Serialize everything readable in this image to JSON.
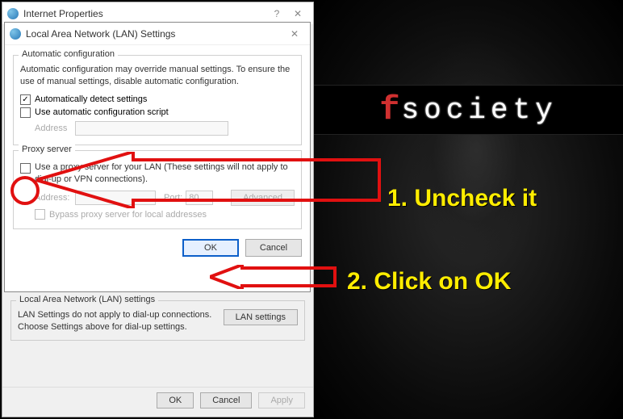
{
  "parentWindow": {
    "title": "Internet Properties",
    "lanSection": {
      "title": "Local Area Network (LAN) settings",
      "info": "LAN Settings do not apply to dial-up connections. Choose Settings above for dial-up settings.",
      "button": "LAN settings"
    },
    "buttons": {
      "ok": "OK",
      "cancel": "Cancel",
      "apply": "Apply"
    }
  },
  "lanDialog": {
    "title": "Local Area Network (LAN) Settings",
    "auto": {
      "title": "Automatic configuration",
      "info": "Automatic configuration may override manual settings.  To ensure the use of manual settings, disable automatic configuration.",
      "cb1": "Automatically detect settings",
      "cb2": "Use automatic configuration script",
      "addressLabel": "Address"
    },
    "proxy": {
      "title": "Proxy server",
      "cb": "Use a proxy server for your LAN (These settings will not apply to dial-up or VPN connections).",
      "addressLabel": "Address:",
      "portLabel": "Port:",
      "portValue": "80",
      "advanced": "Advanced",
      "bypass": "Bypass proxy server for local addresses"
    },
    "buttons": {
      "ok": "OK",
      "cancel": "Cancel"
    }
  },
  "annotations": {
    "step1": "1. Uncheck it",
    "step2": "2. Click on OK"
  },
  "logo": {
    "f": "f",
    "text": "society"
  }
}
